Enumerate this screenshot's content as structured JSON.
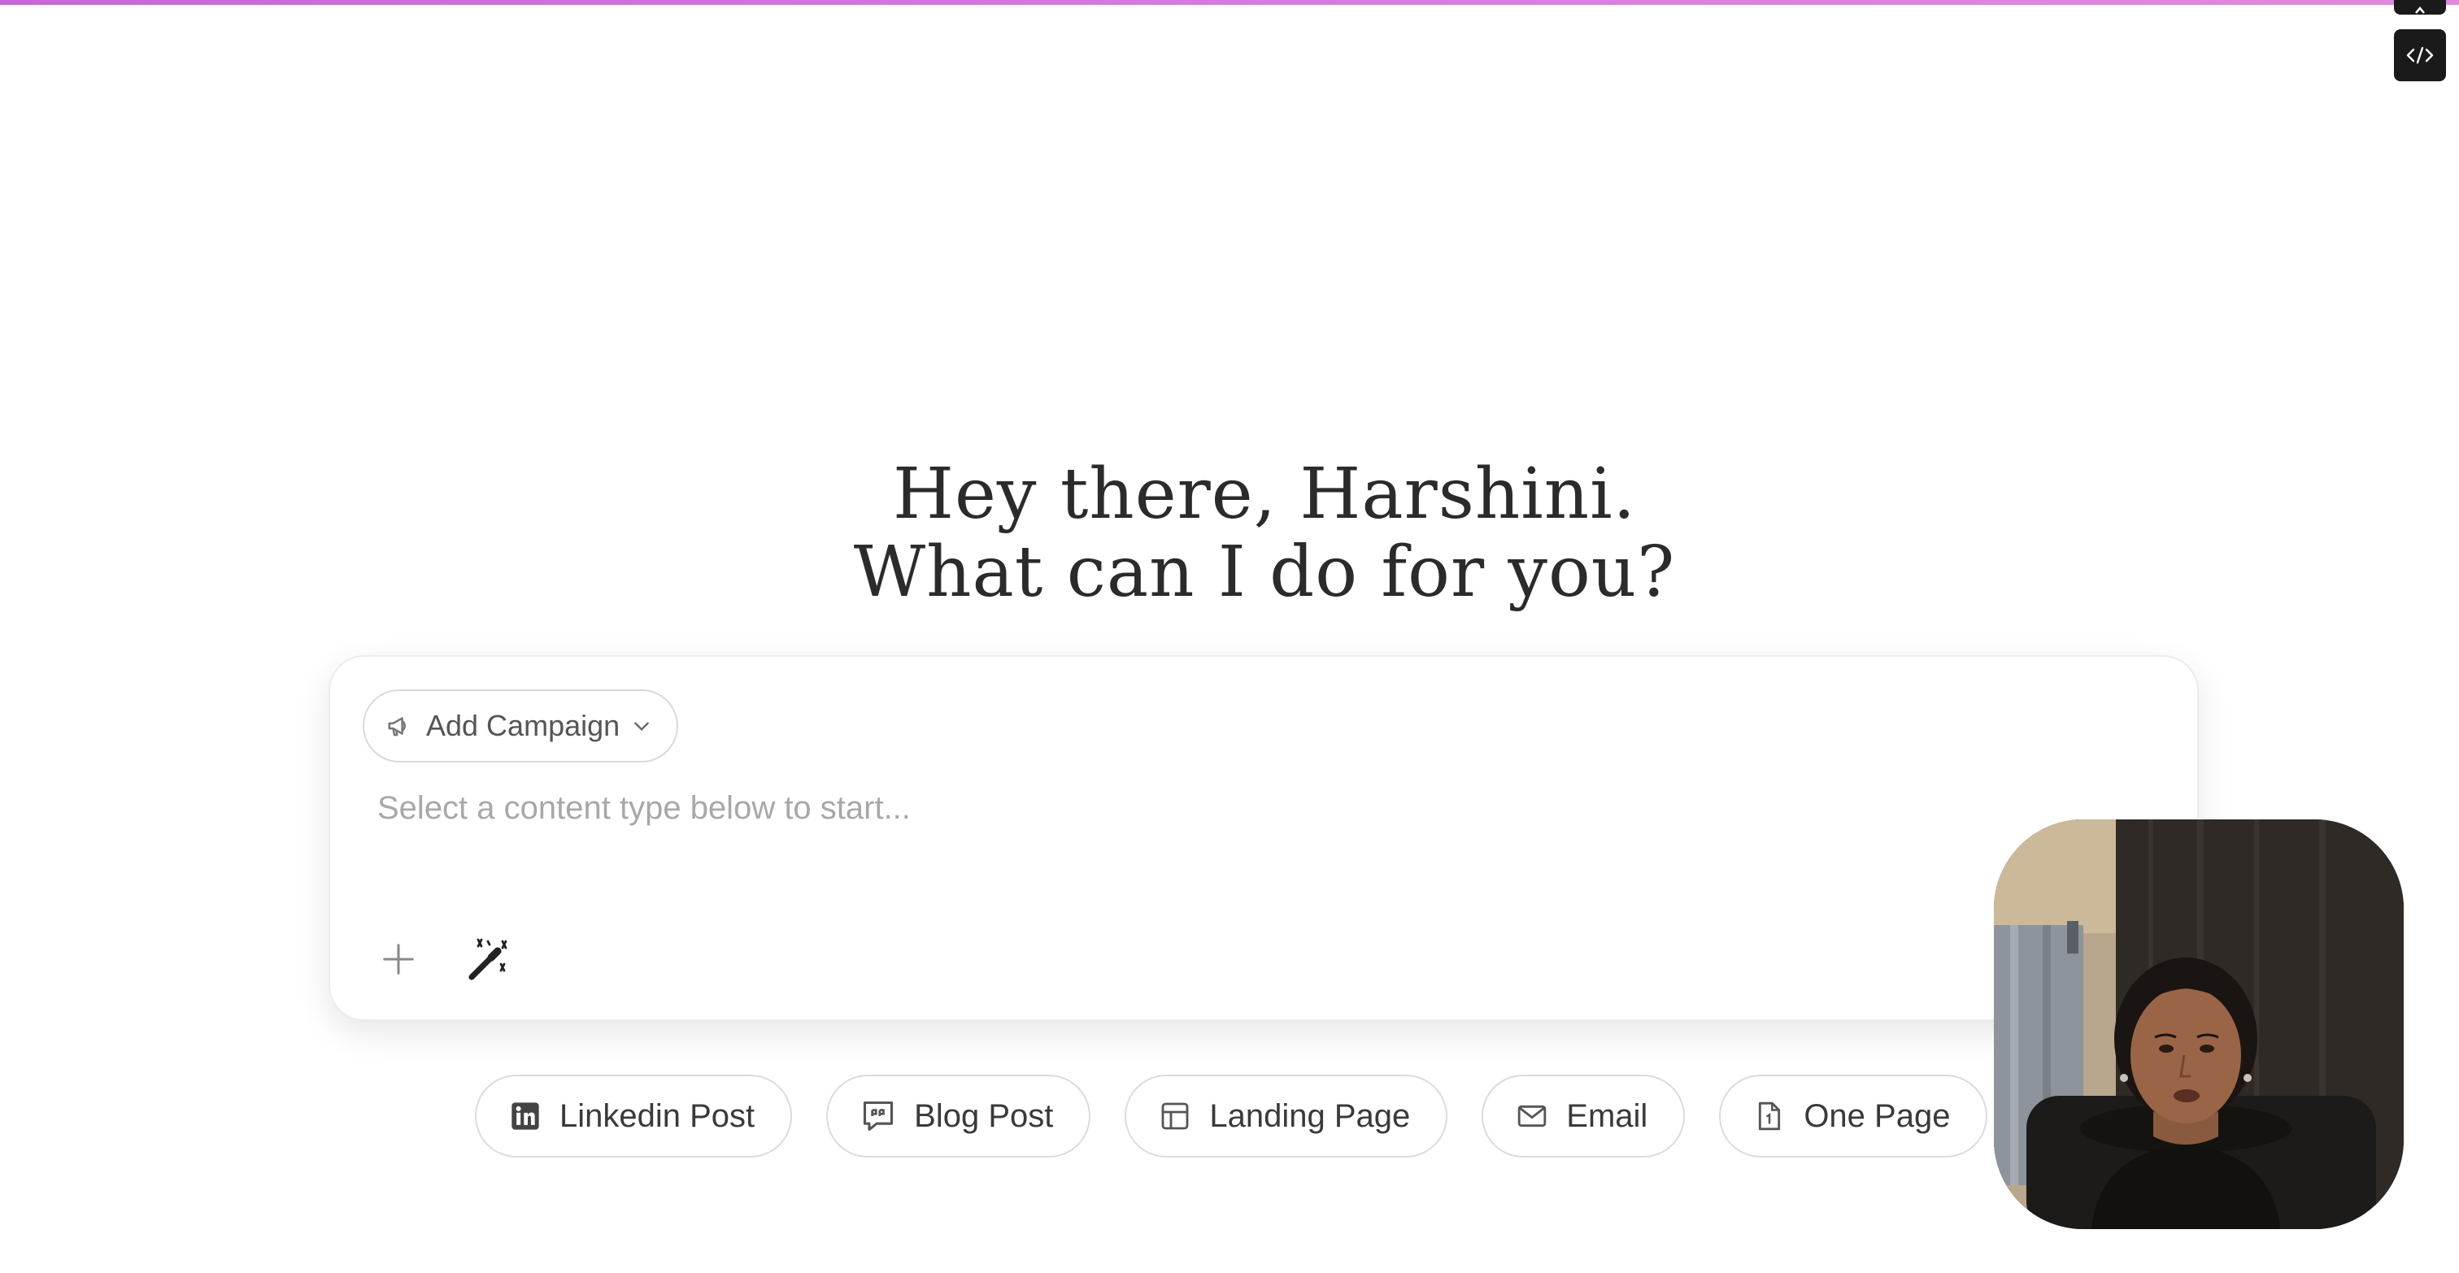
{
  "greeting": {
    "line1": "Hey there, Harshini.",
    "line2": "What can I do for you?"
  },
  "composer": {
    "campaign_label": "Add Campaign",
    "placeholder": "Select a content type below to start..."
  },
  "chips": [
    {
      "label": "Linkedin Post",
      "icon": "linkedin-icon"
    },
    {
      "label": "Blog Post",
      "icon": "quote-icon"
    },
    {
      "label": "Landing Page",
      "icon": "layout-icon"
    },
    {
      "label": "Email",
      "icon": "mail-icon"
    },
    {
      "label": "One Page",
      "icon": "document-icon"
    }
  ],
  "icons": {
    "dev": "code-icon",
    "campaign": "megaphone-icon",
    "campaign_dropdown": "chevron-down-icon",
    "add": "plus-icon",
    "enhance": "magic-wand-icon"
  },
  "colors": {
    "accent_bar": "#d17adc",
    "text": "#2b2b2b",
    "placeholder": "#a8a8a8",
    "border": "#dcdcdc"
  }
}
